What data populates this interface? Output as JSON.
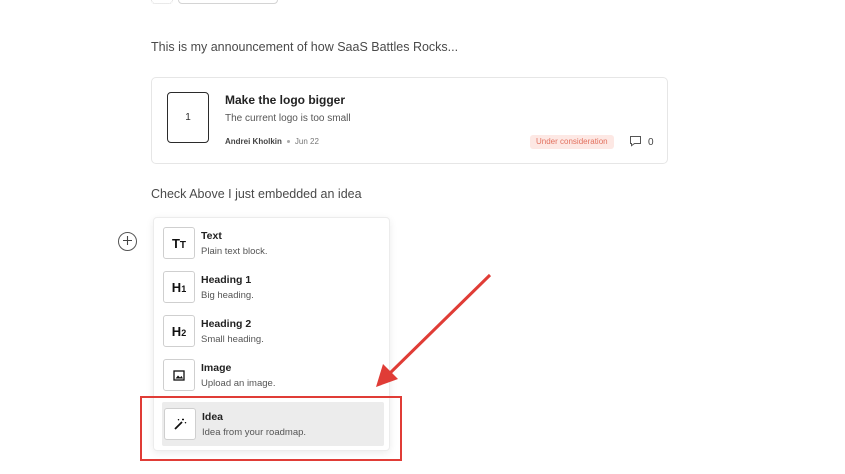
{
  "announcement": "This is my announcement of how SaaS Battles Rocks...",
  "idea_card": {
    "votes": "1",
    "title": "Make the logo bigger",
    "description": "The current logo is too small",
    "author": "Andrei Kholkin",
    "date": "Jun 22",
    "status": "Under consideration",
    "comments": "0",
    "status_color": "#e2715f"
  },
  "check_text": "Check Above I just embedded an idea",
  "block_menu": {
    "items": [
      {
        "icon": "text-type-icon",
        "glyph": "Tт",
        "label": "Text",
        "sub": "Plain text block."
      },
      {
        "icon": "heading1-icon",
        "glyph": "H₁",
        "label": "Heading 1",
        "sub": "Big heading."
      },
      {
        "icon": "heading2-icon",
        "glyph": "H₂",
        "label": "Heading 2",
        "sub": "Small heading."
      },
      {
        "icon": "image-icon",
        "glyph": "",
        "label": "Image",
        "sub": "Upload an image."
      },
      {
        "icon": "magic-wand-icon",
        "glyph": "",
        "label": "Idea",
        "sub": "Idea from your roadmap."
      }
    ]
  },
  "annotation_color": "#e03c36"
}
